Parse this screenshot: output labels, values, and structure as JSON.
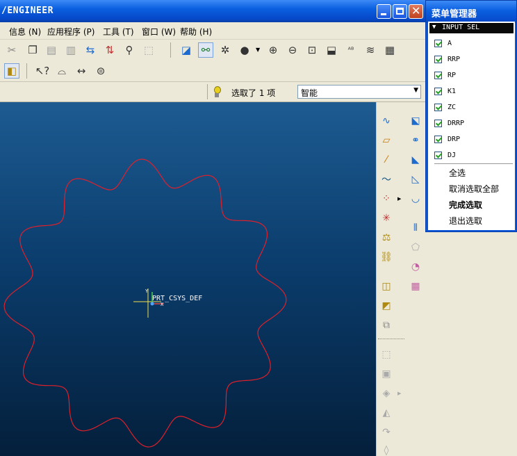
{
  "window": {
    "title": "/ENGINEER"
  },
  "menubar": {
    "items": [
      "信息 (N)",
      "应用程序 (P)",
      "工具 (T)",
      "窗口 (W)",
      "帮助 (H)"
    ]
  },
  "status": {
    "selection_text": "选取了 1 项",
    "filter_value": "智能"
  },
  "canvas": {
    "csys_label": "PRT_CSYS_DEF",
    "axis_y": "Y",
    "axis_x": "X",
    "curve_color": "#e0202a",
    "csys_color": "#f0e050"
  },
  "menu_manager": {
    "title": "菜单管理器",
    "section": "INPUT SEL",
    "options": [
      {
        "label": "A",
        "checked": true
      },
      {
        "label": "RRP",
        "checked": true
      },
      {
        "label": "RP",
        "checked": true
      },
      {
        "label": "K1",
        "checked": true
      },
      {
        "label": "ZC",
        "checked": true
      },
      {
        "label": "DRRP",
        "checked": true
      },
      {
        "label": "DRP",
        "checked": true
      },
      {
        "label": "DJ",
        "checked": true
      }
    ],
    "actions": {
      "select_all": "全选",
      "deselect_all": "取消选取全部",
      "done": "完成选取",
      "quit": "退出选取"
    }
  }
}
